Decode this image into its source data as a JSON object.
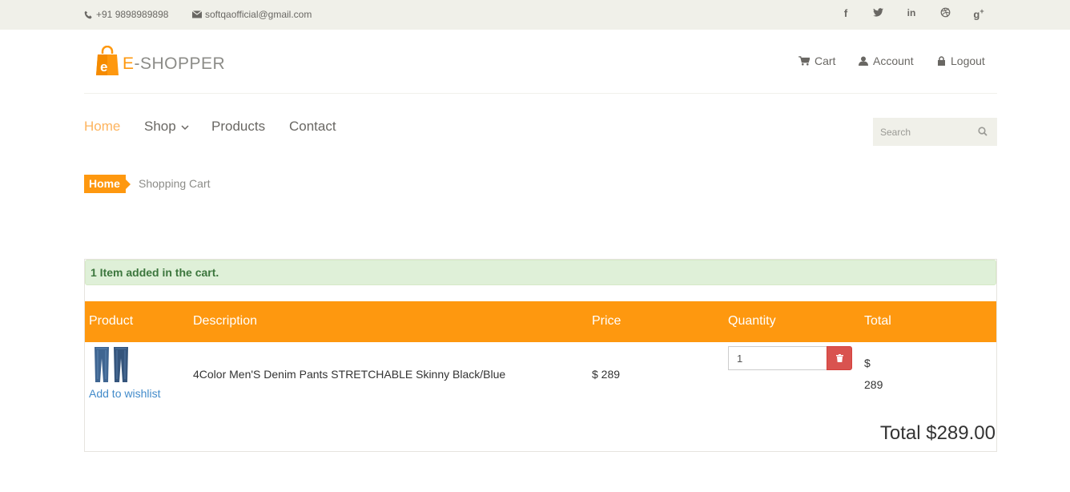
{
  "topbar": {
    "phone": "+91 9898989898",
    "email": "softqaofficial@gmail.com",
    "social": [
      "f",
      "twitter",
      "in",
      "dribbble",
      "g+"
    ]
  },
  "logo": {
    "e_letter": "E",
    "rest": "-SHOPPER",
    "bag_letter": "e"
  },
  "account_nav": {
    "cart": "Cart",
    "account": "Account",
    "logout": "Logout"
  },
  "main_nav": {
    "home": "Home",
    "shop": "Shop",
    "products": "Products",
    "contact": "Contact"
  },
  "search": {
    "placeholder": "Search"
  },
  "breadcrumb": {
    "home": "Home",
    "current": "Shopping Cart"
  },
  "alert": "1 Item added in the cart.",
  "table": {
    "headers": [
      "Product",
      "Description",
      "Price",
      "Quantity",
      "Total"
    ],
    "rows": [
      {
        "wishlist": "Add to wishlist",
        "description": "4Color Men'S Denim Pants STRETCHABLE Skinny Black/Blue",
        "price": "$ 289",
        "quantity": "1",
        "total_currency": "$",
        "total_value": "289"
      }
    ]
  },
  "grand_total": "Total $289.00",
  "colors": {
    "accent": "#fe980f",
    "alert_bg": "#dff0d8",
    "alert_text": "#3c763d",
    "danger": "#d9534f",
    "link": "#428bca"
  }
}
